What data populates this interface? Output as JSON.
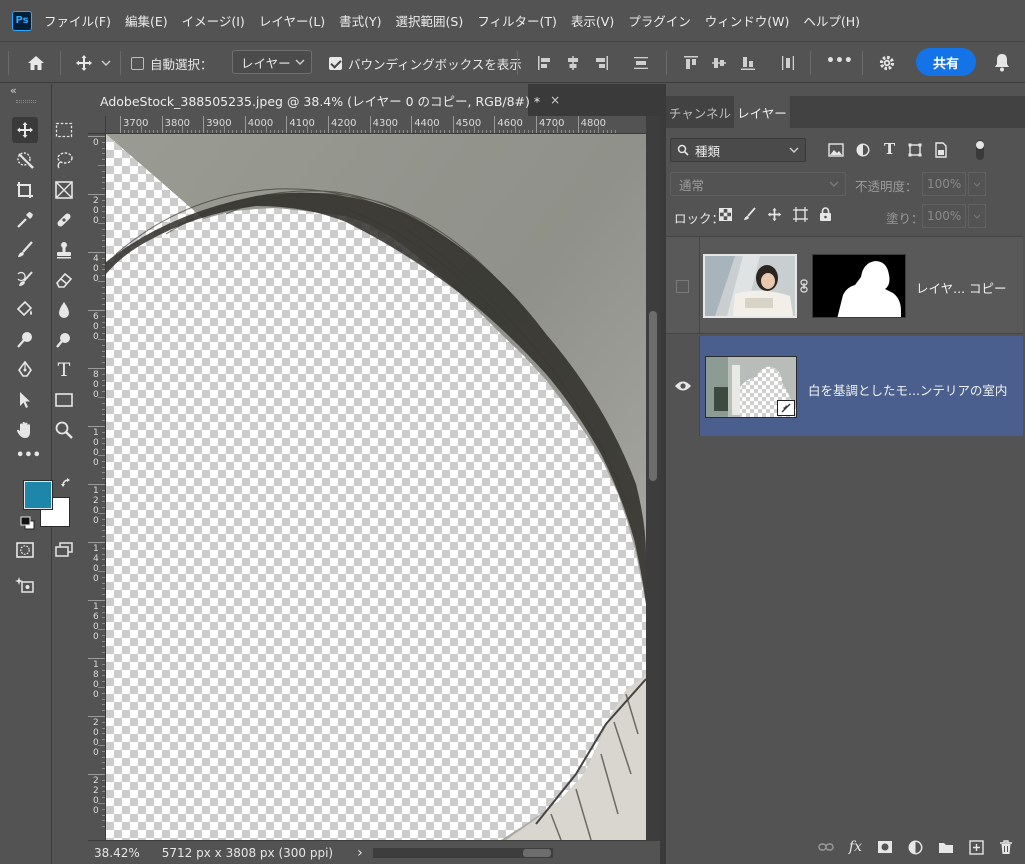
{
  "app": {
    "logo": "Ps",
    "menu": [
      "ファイル(F)",
      "編集(E)",
      "イメージ(I)",
      "レイヤー(L)",
      "書式(Y)",
      "選択範囲(S)",
      "フィルター(T)",
      "表示(V)",
      "プラグイン",
      "ウィンドウ(W)",
      "ヘルプ(H)"
    ]
  },
  "options": {
    "auto_select_label": "自動選択：",
    "auto_select_checked": false,
    "target_value": "レイヤー",
    "bbox_label": "バウンディングボックスを表示",
    "bbox_checked": true,
    "more_label": "•••",
    "share_label": "共有"
  },
  "toolbar": {
    "collapse_label": "«",
    "more_label": "•••",
    "foreground_color": "#1e86a8",
    "background_color": "#ffffff"
  },
  "document": {
    "tab_title": "AdobeStock_388505235.jpeg @ 38.4% (レイヤー 0 のコピー, RGB/8#) *",
    "close_label": "×",
    "ruler_top": [
      "3700",
      "3800",
      "3900",
      "4000",
      "4100",
      "4200",
      "4300",
      "4400",
      "4500",
      "4600",
      "4700",
      "4800"
    ],
    "ruler_left": [
      "0",
      "2\n0\n0",
      "4\n0\n0",
      "6\n0\n0",
      "8\n0\n0",
      "1\n0\n0\n0",
      "1\n2\n0\n0",
      "1\n4\n0\n0",
      "1\n6\n0\n0",
      "1\n8\n0\n0",
      "2\n0\n0\n0",
      "2\n2\n0\n0"
    ],
    "zoom": "38.42%",
    "dimensions": "5712 px x 3808 px (300 ppi)",
    "status_arrow": "›"
  },
  "panel": {
    "tabs": [
      "チャンネル",
      "レイヤー"
    ],
    "active_tab": 1,
    "filter_kind": "種類",
    "blend_mode": "通常",
    "opacity_label": "不透明度：",
    "opacity_value": "100%",
    "lock_label": "ロック：",
    "fill_label": "塗り：",
    "fill_value": "100%",
    "layers": [
      {
        "name": "レイヤ... コピー",
        "visible": false,
        "selected": false,
        "has_mask": true
      },
      {
        "name": "白を基調としたモ...ンテリアの室内",
        "visible": true,
        "selected": true,
        "smart_object": true
      }
    ]
  },
  "colors": {
    "accent": "#1473e6",
    "selected_layer": "#4a5f8e",
    "ps_blue": "#31a8ff"
  }
}
